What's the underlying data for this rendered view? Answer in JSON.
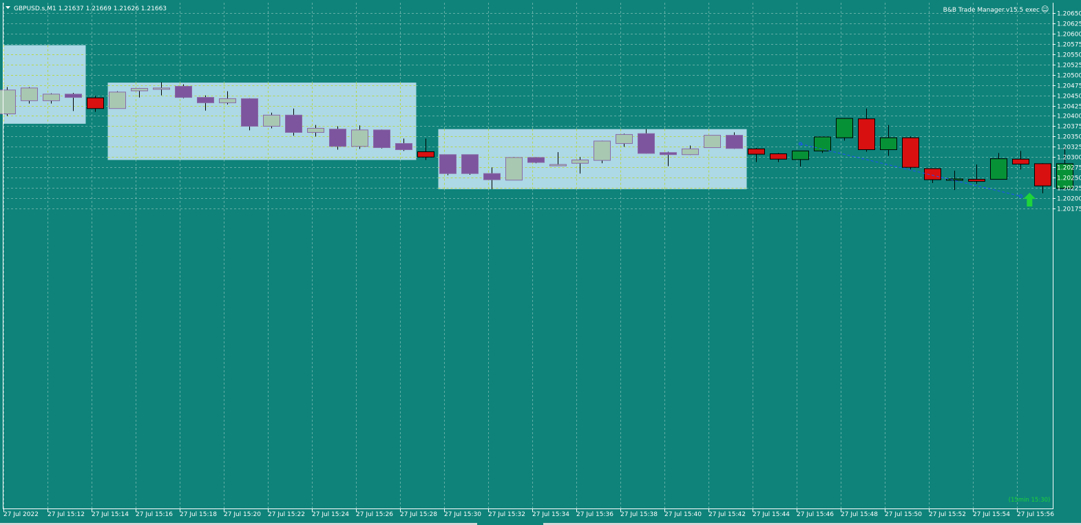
{
  "header": {
    "symbol_line": "GBPUSD.s,M1  1.21637 1.21669 1.21626 1.21663",
    "ea_label": "B&B Trade Manager.v15.5 exec",
    "smiley": "☺"
  },
  "signal": {
    "label": "(15min 15:30)",
    "color": "#1fd43a"
  },
  "colors": {
    "background": "#0f837a",
    "grid": "#a9d3cd",
    "zone_fill": "#add8e6",
    "zone_grid": "#b5d84a",
    "bull_in_zone": "#a8c8b2",
    "bear_in_zone": "#7c559e",
    "bull": "#079137",
    "bear": "#d81010",
    "wick": "#000000",
    "trendline": "#1f4fff",
    "axis_text": "#ffffff"
  },
  "chart_data": {
    "type": "candlestick",
    "symbol": "GBPUSD.s",
    "timeframe": "M1",
    "ylim": [
      1.20175,
      1.20662
    ],
    "y_ticks": [
      "1.20650",
      "1.20625",
      "1.20600",
      "1.20575",
      "1.20550",
      "1.20525",
      "1.20500",
      "1.20475",
      "1.20450",
      "1.20425",
      "1.20400",
      "1.20375",
      "1.20350",
      "1.20325",
      "1.20300",
      "1.20275",
      "1.20250",
      "1.20225",
      "1.20200",
      "1.20175"
    ],
    "x_ticks": [
      "27 Jul 2022",
      "27 Jul 15:12",
      "27 Jul 15:14",
      "27 Jul 15:16",
      "27 Jul 15:18",
      "27 Jul 15:20",
      "27 Jul 15:22",
      "27 Jul 15:24",
      "27 Jul 15:26",
      "27 Jul 15:28",
      "27 Jul 15:30",
      "27 Jul 15:32",
      "27 Jul 15:34",
      "27 Jul 15:36",
      "27 Jul 15:38",
      "27 Jul 15:40",
      "27 Jul 15:42",
      "27 Jul 15:44",
      "27 Jul 15:46",
      "27 Jul 15:48",
      "27 Jul 15:50",
      "27 Jul 15:52",
      "27 Jul 15:54",
      "27 Jul 15:56"
    ],
    "zones": [
      {
        "start_bar": -0.5,
        "end_bar": 4,
        "top": 1.20572,
        "bottom": 1.20381
      },
      {
        "start_bar": 5,
        "end_bar": 19,
        "top": 1.20481,
        "bottom": 1.20293
      },
      {
        "start_bar": 20,
        "end_bar": 34,
        "top": 1.20368,
        "bottom": 1.20222
      }
    ],
    "trendline": {
      "from": {
        "bar": 36,
        "price": 1.20332
      },
      "to": {
        "bar": 46,
        "price": 1.20205
      }
    },
    "signal_arrow": {
      "bar": 46.4,
      "price": 1.2019,
      "direction": "up"
    },
    "candles": [
      {
        "t": "15:11",
        "o": 1.20405,
        "h": 1.2047,
        "l": 1.204,
        "c": 1.20463
      },
      {
        "t": "15:12",
        "o": 1.20437,
        "h": 1.2047,
        "l": 1.2043,
        "c": 1.20468
      },
      {
        "t": "15:13",
        "o": 1.20437,
        "h": 1.20455,
        "l": 1.2043,
        "c": 1.20453
      },
      {
        "t": "15:14",
        "o": 1.20453,
        "h": 1.20456,
        "l": 1.20412,
        "c": 1.20445
      },
      {
        "t": "15:15",
        "o": 1.20444,
        "h": 1.20449,
        "l": 1.2041,
        "c": 1.20418
      },
      {
        "t": "15:16",
        "o": 1.20418,
        "h": 1.2046,
        "l": 1.20418,
        "c": 1.20458
      },
      {
        "t": "15:17",
        "o": 1.20461,
        "h": 1.20468,
        "l": 1.20445,
        "c": 1.20467
      },
      {
        "t": "15:18",
        "o": 1.20465,
        "h": 1.20482,
        "l": 1.2045,
        "c": 1.20468
      },
      {
        "t": "15:19",
        "o": 1.20472,
        "h": 1.20477,
        "l": 1.20443,
        "c": 1.20445
      },
      {
        "t": "15:20",
        "o": 1.20445,
        "h": 1.2045,
        "l": 1.20413,
        "c": 1.20432
      },
      {
        "t": "15:21",
        "o": 1.20432,
        "h": 1.2046,
        "l": 1.20428,
        "c": 1.20442
      },
      {
        "t": "15:22",
        "o": 1.20442,
        "h": 1.20443,
        "l": 1.20365,
        "c": 1.20375
      },
      {
        "t": "15:23",
        "o": 1.20375,
        "h": 1.20408,
        "l": 1.2037,
        "c": 1.20402
      },
      {
        "t": "15:24",
        "o": 1.20402,
        "h": 1.20418,
        "l": 1.20352,
        "c": 1.2036
      },
      {
        "t": "15:25",
        "o": 1.2036,
        "h": 1.20378,
        "l": 1.2035,
        "c": 1.2037
      },
      {
        "t": "15:26",
        "o": 1.20368,
        "h": 1.20375,
        "l": 1.20318,
        "c": 1.20326
      },
      {
        "t": "15:27",
        "o": 1.20326,
        "h": 1.20377,
        "l": 1.2032,
        "c": 1.20366
      },
      {
        "t": "15:28",
        "o": 1.20366,
        "h": 1.20367,
        "l": 1.20321,
        "c": 1.20323
      },
      {
        "t": "15:29",
        "o": 1.20333,
        "h": 1.20345,
        "l": 1.20315,
        "c": 1.20318
      },
      {
        "t": "15:30",
        "o": 1.20313,
        "h": 1.20345,
        "l": 1.20293,
        "c": 1.203
      },
      {
        "t": "15:31",
        "o": 1.20306,
        "h": 1.20306,
        "l": 1.20256,
        "c": 1.2026
      },
      {
        "t": "15:32",
        "o": 1.20306,
        "h": 1.20306,
        "l": 1.20257,
        "c": 1.2026
      },
      {
        "t": "15:33",
        "o": 1.2026,
        "h": 1.20275,
        "l": 1.20222,
        "c": 1.20245
      },
      {
        "t": "15:34",
        "o": 1.20244,
        "h": 1.203,
        "l": 1.20244,
        "c": 1.20299
      },
      {
        "t": "15:35",
        "o": 1.20299,
        "h": 1.203,
        "l": 1.20285,
        "c": 1.20287
      },
      {
        "t": "15:36",
        "o": 1.20282,
        "h": 1.20312,
        "l": 1.2028,
        "c": 1.20282
      },
      {
        "t": "15:37",
        "o": 1.20285,
        "h": 1.203,
        "l": 1.2026,
        "c": 1.20293
      },
      {
        "t": "15:38",
        "o": 1.20292,
        "h": 1.2034,
        "l": 1.20285,
        "c": 1.20339
      },
      {
        "t": "15:39",
        "o": 1.20333,
        "h": 1.20357,
        "l": 1.20325,
        "c": 1.20355
      },
      {
        "t": "15:40",
        "o": 1.20357,
        "h": 1.20368,
        "l": 1.20308,
        "c": 1.20309
      },
      {
        "t": "15:41",
        "o": 1.20311,
        "h": 1.20313,
        "l": 1.20278,
        "c": 1.20306
      },
      {
        "t": "15:42",
        "o": 1.20306,
        "h": 1.20328,
        "l": 1.20305,
        "c": 1.2032
      },
      {
        "t": "15:43",
        "o": 1.20323,
        "h": 1.20353,
        "l": 1.20323,
        "c": 1.20353
      },
      {
        "t": "15:44",
        "o": 1.20353,
        "h": 1.2036,
        "l": 1.2032,
        "c": 1.20321
      },
      {
        "t": "15:45",
        "o": 1.2032,
        "h": 1.20322,
        "l": 1.20288,
        "c": 1.20307
      },
      {
        "t": "15:46",
        "o": 1.20308,
        "h": 1.2031,
        "l": 1.20288,
        "c": 1.20295
      },
      {
        "t": "15:47",
        "o": 1.20294,
        "h": 1.20315,
        "l": 1.20277,
        "c": 1.20315
      },
      {
        "t": "15:48",
        "o": 1.20315,
        "h": 1.20349,
        "l": 1.2031,
        "c": 1.20349
      },
      {
        "t": "15:49",
        "o": 1.20347,
        "h": 1.20395,
        "l": 1.2034,
        "c": 1.20394
      },
      {
        "t": "15:50",
        "o": 1.20393,
        "h": 1.20418,
        "l": 1.20313,
        "c": 1.20318
      },
      {
        "t": "15:51",
        "o": 1.20318,
        "h": 1.20378,
        "l": 1.20303,
        "c": 1.20347
      },
      {
        "t": "15:52",
        "o": 1.20347,
        "h": 1.2035,
        "l": 1.2027,
        "c": 1.20275
      },
      {
        "t": "15:53",
        "o": 1.20272,
        "h": 1.20273,
        "l": 1.20237,
        "c": 1.20245
      },
      {
        "t": "15:54",
        "o": 1.20246,
        "h": 1.20267,
        "l": 1.2022,
        "c": 1.20247
      },
      {
        "t": "15:55",
        "o": 1.20246,
        "h": 1.20282,
        "l": 1.20235,
        "c": 1.20241
      },
      {
        "t": "15:56",
        "o": 1.20246,
        "h": 1.2031,
        "l": 1.20246,
        "c": 1.20296
      },
      {
        "t": "15:57",
        "o": 1.20295,
        "h": 1.20315,
        "l": 1.2027,
        "c": 1.20283
      },
      {
        "t": "15:58",
        "o": 1.20284,
        "h": 1.20285,
        "l": 1.20212,
        "c": 1.2023
      },
      {
        "t": "15:59",
        "o": 1.20224,
        "h": 1.20326,
        "l": 1.2022,
        "c": 1.20284
      }
    ]
  }
}
